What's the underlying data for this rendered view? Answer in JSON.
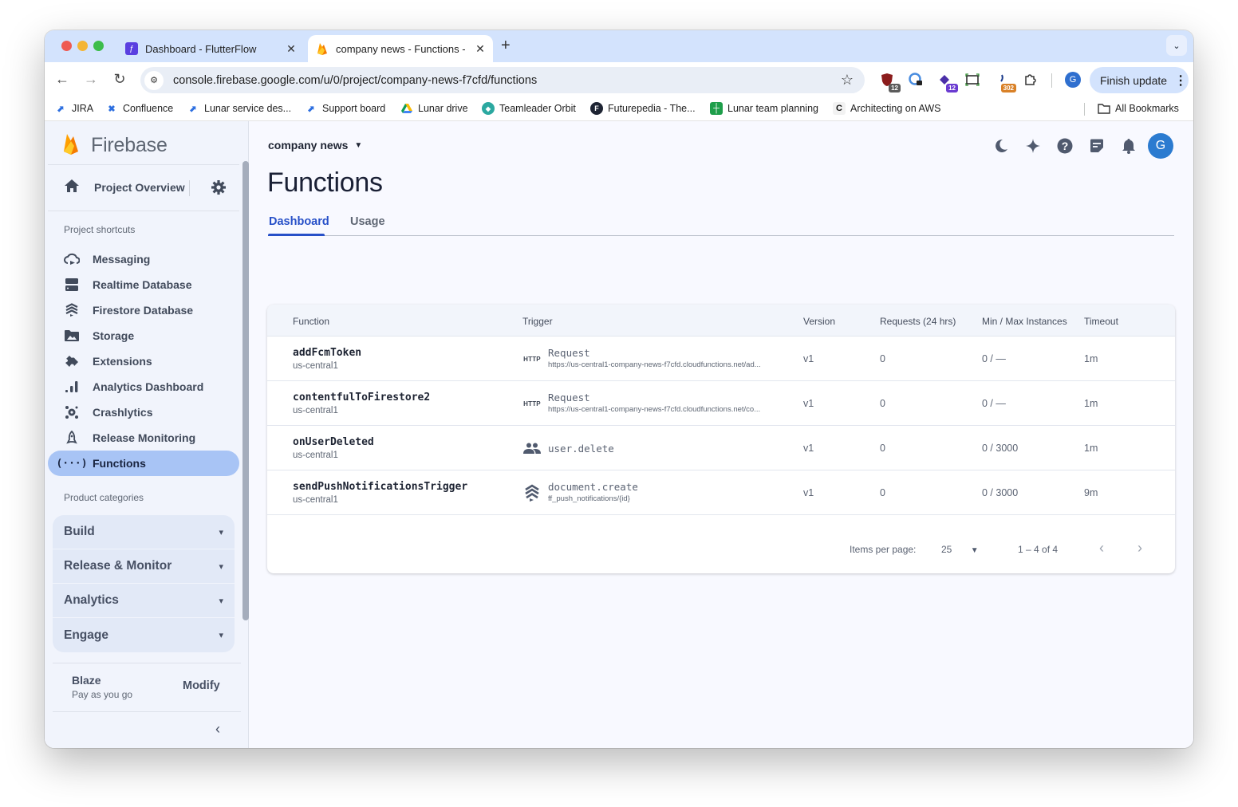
{
  "browser": {
    "tabs": [
      {
        "title": "Dashboard - FlutterFlow",
        "icon": "flutterflow-icon",
        "active": false
      },
      {
        "title": "company news - Functions - ",
        "icon": "firebase-icon",
        "active": true
      }
    ],
    "new_tab": "+",
    "url": "console.firebase.google.com/u/0/project/company-news-f7cfd/functions",
    "extensions": [
      {
        "name": "ublock-shield-icon",
        "badge": "12",
        "badge_color": "#5b5b5b"
      },
      {
        "name": "password-lock-icon",
        "badge": ""
      },
      {
        "name": "purple-ext-icon",
        "badge": "12",
        "badge_color": "#6a3bd1"
      },
      {
        "name": "screenshot-frame-icon",
        "badge": ""
      },
      {
        "name": "orange-ext-icon",
        "badge": "302",
        "badge_color": "#d98128"
      },
      {
        "name": "extensions-puzzle-icon",
        "badge": ""
      }
    ],
    "profile_initial": "G",
    "finish_update": "Finish update",
    "bookmarks": [
      {
        "label": "JIRA",
        "icon": "jira-icon"
      },
      {
        "label": "Confluence",
        "icon": "confluence-icon"
      },
      {
        "label": "Lunar service des...",
        "icon": "jira-icon"
      },
      {
        "label": "Support board",
        "icon": "jira-icon"
      },
      {
        "label": "Lunar drive",
        "icon": "google-drive-icon"
      },
      {
        "label": "Teamleader Orbit",
        "icon": "teamleader-icon"
      },
      {
        "label": "Futurepedia - The...",
        "icon": "futurepedia-icon"
      },
      {
        "label": "Lunar team planning",
        "icon": "sheets-icon"
      },
      {
        "label": "Architecting on AWS",
        "icon": "aws-course-icon"
      }
    ],
    "all_bookmarks": "All Bookmarks"
  },
  "sidebar": {
    "brand": "Firebase",
    "project_overview": "Project Overview",
    "shortcuts_title": "Project shortcuts",
    "items": [
      {
        "label": "Messaging",
        "icon": "messaging-icon"
      },
      {
        "label": "Realtime Database",
        "icon": "realtime-database-icon"
      },
      {
        "label": "Firestore Database",
        "icon": "firestore-icon"
      },
      {
        "label": "Storage",
        "icon": "storage-icon"
      },
      {
        "label": "Extensions",
        "icon": "extensions-icon"
      },
      {
        "label": "Analytics Dashboard",
        "icon": "analytics-icon"
      },
      {
        "label": "Crashlytics",
        "icon": "crashlytics-icon"
      },
      {
        "label": "Release Monitoring",
        "icon": "release-monitoring-icon"
      },
      {
        "label": "Functions",
        "icon": "functions-icon",
        "active": true
      }
    ],
    "categories_title": "Product categories",
    "categories": [
      "Build",
      "Release & Monitor",
      "Analytics",
      "Engage"
    ],
    "plan": {
      "name": "Blaze",
      "subtitle": "Pay as you go",
      "action": "Modify"
    }
  },
  "header": {
    "project": "company news",
    "title": "Functions",
    "tabs": [
      {
        "label": "Dashboard",
        "active": true
      },
      {
        "label": "Usage",
        "active": false
      }
    ]
  },
  "table": {
    "columns": [
      "Function",
      "Trigger",
      "Version",
      "Requests (24 hrs)",
      "Min / Max Instances",
      "Timeout"
    ],
    "rows": [
      {
        "name": "addFcmToken",
        "region": "us-central1",
        "trigger_type": "HTTP",
        "trigger": "Request",
        "trigger_detail": "https://us-central1-company-news-f7cfd.cloudfunctions.net/ad...",
        "version": "v1",
        "requests": "0",
        "instances": "0 / —",
        "timeout": "1m"
      },
      {
        "name": "contentfulToFirestore2",
        "region": "us-central1",
        "trigger_type": "HTTP",
        "trigger": "Request",
        "trigger_detail": "https://us-central1-company-news-f7cfd.cloudfunctions.net/co...",
        "version": "v1",
        "requests": "0",
        "instances": "0 / —",
        "timeout": "1m"
      },
      {
        "name": "onUserDeleted",
        "region": "us-central1",
        "trigger_type": "auth",
        "trigger": "user.delete",
        "trigger_detail": "",
        "version": "v1",
        "requests": "0",
        "instances": "0 / 3000",
        "timeout": "1m"
      },
      {
        "name": "sendPushNotificationsTrigger",
        "region": "us-central1",
        "trigger_type": "firestore",
        "trigger": "document.create",
        "trigger_detail": "ff_push_notifications/{id}",
        "version": "v1",
        "requests": "0",
        "instances": "0 / 3000",
        "timeout": "9m"
      }
    ],
    "pagination": {
      "items_per_page_label": "Items per page:",
      "items_per_page": "25",
      "range": "1 – 4 of 4"
    }
  },
  "colors": {
    "accent": "#2750c8",
    "active_nav": "#a8c4f5",
    "avatar": "#2b7bd0"
  }
}
